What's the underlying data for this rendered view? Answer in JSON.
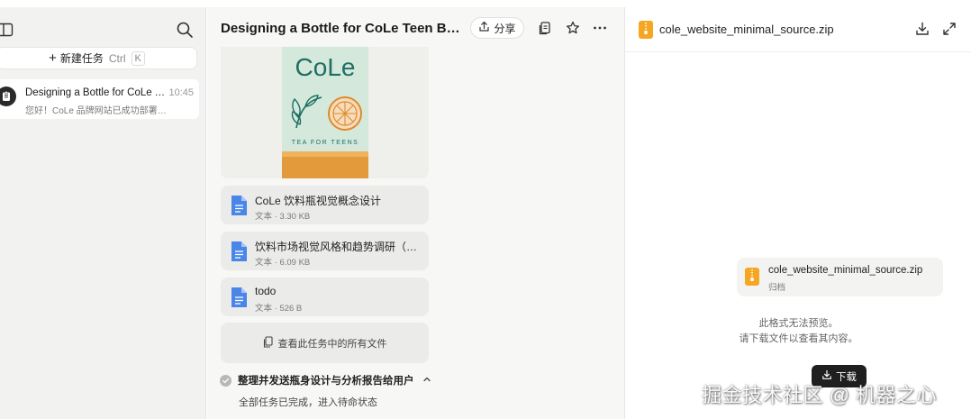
{
  "sidebar": {
    "new_task": {
      "label": "新建任务",
      "shortcut_key1": "Ctrl",
      "shortcut_key2": "K"
    },
    "tasks": [
      {
        "title": "Designing a Bottle for CoLe T...",
        "time": "10:45",
        "preview": "您好！CoLe 品牌网站已成功部署。..."
      }
    ]
  },
  "chat": {
    "title": "Designing a Bottle for CoLe Teen Beve...",
    "share_label": "分享",
    "image": {
      "brand": "CoLe",
      "tagline": "TEA FOR TEENS"
    },
    "files": [
      {
        "name": "CoLe 饮料瓶视觉概念设计",
        "meta": "文本 · 3.30 KB",
        "icon": "doc-icon"
      },
      {
        "name": "饮料市场视觉风格和趋势调研（基...",
        "meta": "文本 · 6.09 KB",
        "icon": "doc-icon"
      },
      {
        "name": "todo",
        "meta": "文本 · 526 B",
        "icon": "doc-icon"
      }
    ],
    "view_all_files": "查看此任务中的所有文件",
    "step": {
      "title": "整理并发送瓶身设计与分析报告给用户",
      "status": "全部任务已完成，进入待命状态"
    }
  },
  "preview": {
    "filename": "cole_website_minimal_source.zip",
    "card": {
      "name": "cole_website_minimal_source.zip",
      "type": "归档"
    },
    "message_line1": "此格式无法预览。",
    "message_line2": "请下载文件以查看其内容。",
    "download_label": "下载"
  },
  "watermark": "掘金技术社区 @ 机器之心",
  "colors": {
    "accent_zip": "#f5a623",
    "doc_blue": "#4a86e8",
    "dark_button": "#1f1f1f"
  }
}
